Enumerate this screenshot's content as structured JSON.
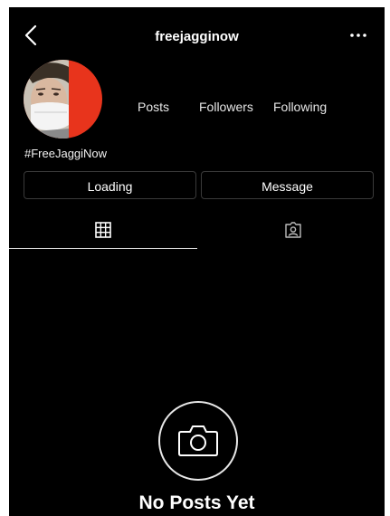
{
  "header": {
    "username": "freejagginow",
    "back_icon": "chevron-left-icon",
    "more_icon": "more-horizontal-icon"
  },
  "profile": {
    "stats": {
      "posts_label": "Posts",
      "followers_label": "Followers",
      "following_label": "Following"
    },
    "bio": "#FreeJaggiNow",
    "avatar_accent": "#e8341c"
  },
  "actions": {
    "follow_label": "Loading",
    "message_label": "Message"
  },
  "tabs": {
    "grid_icon": "grid-icon",
    "tagged_icon": "tagged-person-icon",
    "active": "grid"
  },
  "empty_state": {
    "icon": "camera-icon",
    "title": "No Posts Yet"
  }
}
